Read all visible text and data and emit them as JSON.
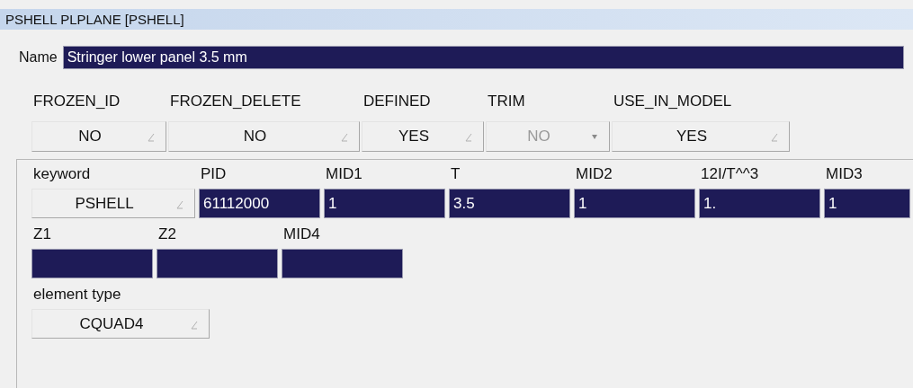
{
  "window": {
    "title": "PSHELL PLPLANE [PSHELL]"
  },
  "name": {
    "label": "Name",
    "value": "Stringer lower panel 3.5 mm"
  },
  "flags": [
    {
      "label": "FROZEN_ID",
      "value": "NO",
      "disabled": false
    },
    {
      "label": "FROZEN_DELETE",
      "value": "NO",
      "disabled": false
    },
    {
      "label": "DEFINED",
      "value": "YES",
      "disabled": false
    },
    {
      "label": "TRIM",
      "value": "NO",
      "disabled": true
    },
    {
      "label": "USE_IN_MODEL",
      "value": "YES",
      "disabled": false
    }
  ],
  "card_rows": [
    {
      "fields": [
        {
          "label": "keyword",
          "kind": "dropdown",
          "value": "PSHELL"
        },
        {
          "label": "PID",
          "kind": "text",
          "value": "61112000"
        },
        {
          "label": "MID1",
          "kind": "text",
          "value": "1"
        },
        {
          "label": "T",
          "kind": "text",
          "value": "3.5"
        },
        {
          "label": "MID2",
          "kind": "text",
          "value": "1"
        },
        {
          "label": "12I/T^^3",
          "kind": "text",
          "value": "1."
        },
        {
          "label": "MID3",
          "kind": "text",
          "value": "1"
        }
      ]
    },
    {
      "fields": [
        {
          "label": "Z1",
          "kind": "text"
        },
        {
          "label": "Z2",
          "kind": "text"
        },
        {
          "label": "MID4",
          "kind": "text"
        }
      ]
    },
    {
      "fields": [
        {
          "label": "element type",
          "kind": "dropdown",
          "value": "CQUAD4"
        }
      ]
    }
  ]
}
